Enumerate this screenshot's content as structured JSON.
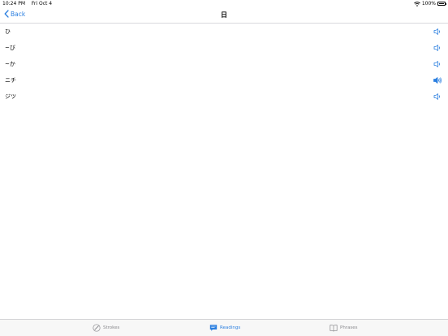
{
  "status_bar": {
    "time": "10:24 PM",
    "date": "Fri Oct 4",
    "battery": "100%"
  },
  "nav": {
    "back_label": "Back",
    "title": "日"
  },
  "readings": [
    {
      "text": "ひ",
      "speaker_active": false
    },
    {
      "text": "~び",
      "speaker_active": false
    },
    {
      "text": "~か",
      "speaker_active": false
    },
    {
      "text": "ニチ",
      "speaker_active": true
    },
    {
      "text": "ジツ",
      "speaker_active": false
    }
  ],
  "tabs": [
    {
      "label": "Strokes",
      "icon": "pencil-icon",
      "active": false
    },
    {
      "label": "Readings",
      "icon": "speech-bubble-icon",
      "active": true
    },
    {
      "label": "Phrases",
      "icon": "book-icon",
      "active": false
    }
  ],
  "colors": {
    "accent": "#2b7fe0",
    "inactive": "#8a8a8e",
    "separator": "#d9d9dd"
  }
}
